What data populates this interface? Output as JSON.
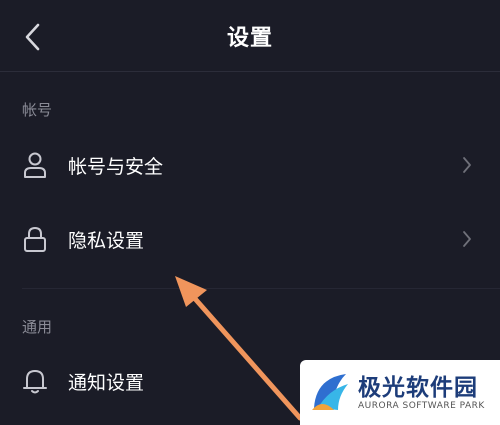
{
  "header": {
    "title": "设置"
  },
  "sections": [
    {
      "label": "帐号"
    },
    {
      "label": "通用"
    }
  ],
  "items": [
    {
      "label": "帐号与安全",
      "icon": "user-icon"
    },
    {
      "label": "隐私设置",
      "icon": "lock-icon"
    },
    {
      "label": "通知设置",
      "icon": "bell-icon"
    }
  ],
  "annotation": {
    "arrow_color": "#f0955c"
  },
  "watermark": {
    "name": "极光软件园",
    "sub": "AURORA SOFTWARE PARK"
  },
  "colors": {
    "background": "#1b1c27",
    "text": "#ffffff",
    "muted": "#8a8b96"
  }
}
